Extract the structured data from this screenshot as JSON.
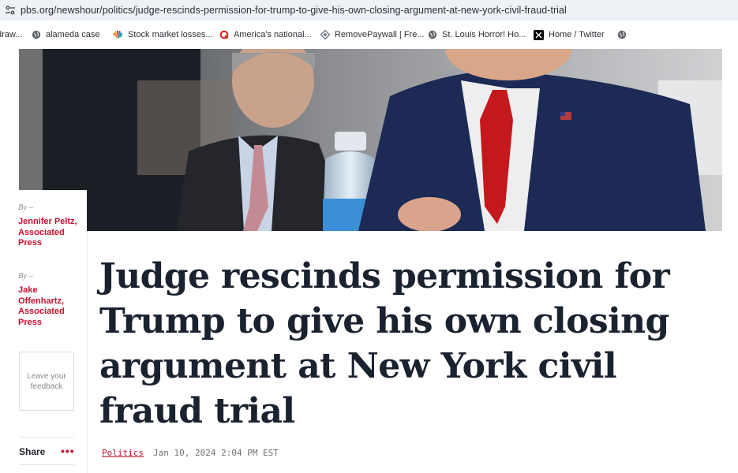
{
  "browser": {
    "url": "pbs.org/newshour/politics/judge-rescinds-permission-for-trump-to-give-his-own-closing-argument-at-new-york-civil-fraud-trial",
    "bookmarks": [
      {
        "label": "draw...",
        "icon": "none"
      },
      {
        "label": "alameda case",
        "icon": "globe-icon"
      },
      {
        "label": "Stock market losses...",
        "icon": "nbc-peacock-icon"
      },
      {
        "label": "America's national...",
        "icon": "quartz-q-icon"
      },
      {
        "label": "RemovePaywall | Fre...",
        "icon": "diamond-icon"
      },
      {
        "label": "St. Louis Horror! Ho...",
        "icon": "globe-icon"
      },
      {
        "label": "Home / Twitter",
        "icon": "x-logo-icon"
      },
      {
        "label": "",
        "icon": "globe-icon"
      }
    ]
  },
  "article": {
    "authors": [
      {
        "by": "By –",
        "name": "Jennifer Peltz, Associated Press"
      },
      {
        "by": "By –",
        "name": "Jake Offenhartz, Associated Press"
      }
    ],
    "feedback_label": "Leave your feedback",
    "share_label": "Share",
    "share_more": "•••",
    "headline": "Judge rescinds permission for Trump to give his own closing argument at New York civil fraud trial",
    "category": "Politics",
    "date": "Jan 10, 2024 2:04 PM EST"
  },
  "colors": {
    "accent": "#c8102e",
    "headline": "#1a2230",
    "address_bar_bg": "#eef1f6"
  }
}
